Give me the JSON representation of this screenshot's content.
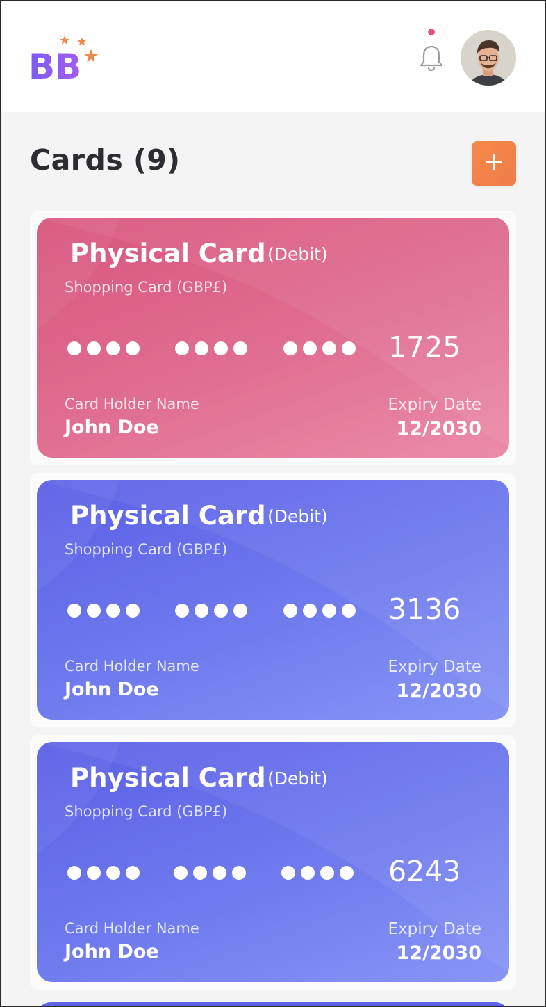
{
  "header": {
    "logo_text": "BB",
    "icons": {
      "notifications": "bell-icon",
      "avatar": "user-avatar"
    },
    "colors": {
      "logo_gradient": [
        "#7c5cf2",
        "#a45df3"
      ],
      "stars": "#f08a4b",
      "notif_dot": "#e0527a"
    }
  },
  "page": {
    "title": "Cards (9)",
    "add_button_label": "+"
  },
  "cards": [
    {
      "title": "Physical Card",
      "type": "(Debit)",
      "subtitle": "Shopping Card (GBP£)",
      "last4": "1725",
      "holder_label": "Card Holder Name",
      "holder_name": "John Doe",
      "expiry_label": "Expiry Date",
      "expiry": "12/2030",
      "theme": "pink"
    },
    {
      "title": "Physical Card",
      "type": "(Debit)",
      "subtitle": "Shopping Card (GBP£)",
      "last4": "3136",
      "holder_label": "Card Holder Name",
      "holder_name": "John Doe",
      "expiry_label": "Expiry Date",
      "expiry": "12/2030",
      "theme": "blue"
    },
    {
      "title": "Physical Card",
      "type": "(Debit)",
      "subtitle": "Shopping Card (GBP£)",
      "last4": "6243",
      "holder_label": "Card Holder Name",
      "holder_name": "John Doe",
      "expiry_label": "Expiry Date",
      "expiry": "12/2030",
      "theme": "blue"
    }
  ]
}
